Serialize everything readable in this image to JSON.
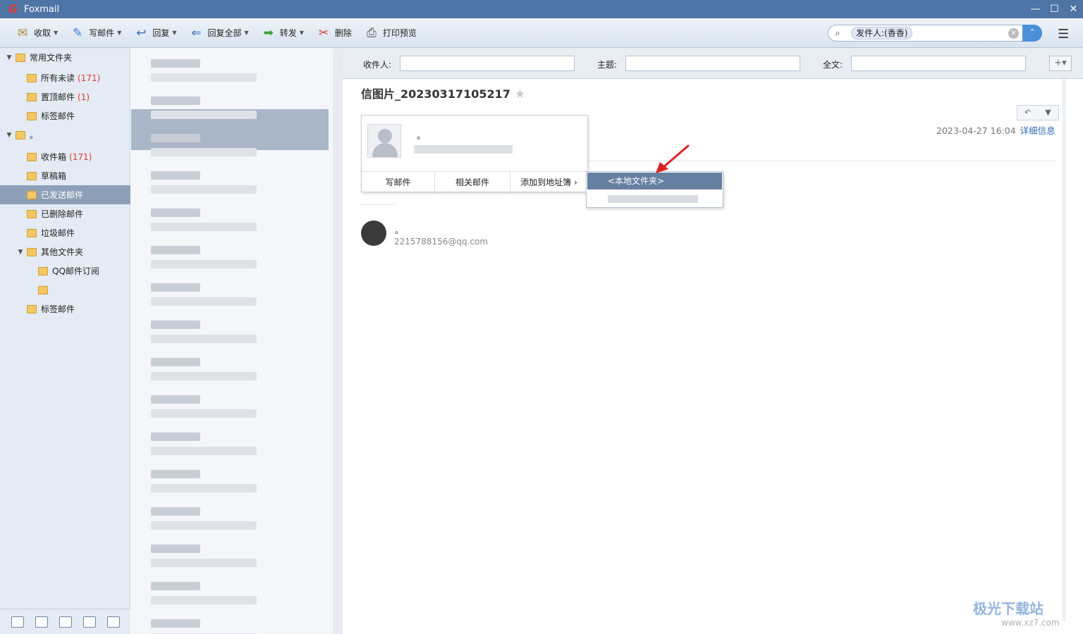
{
  "window": {
    "title": "Foxmail",
    "controls": [
      "—",
      "☐",
      "✕"
    ]
  },
  "toolbar": {
    "items": [
      {
        "label": "收取",
        "icon": "inbox-icon",
        "glyph": "✉",
        "caret": "▼"
      },
      {
        "label": "写邮件",
        "icon": "feather-pen-icon",
        "glyph": "✎",
        "caret": "▼"
      },
      {
        "label": "回复",
        "icon": "reply-icon",
        "glyph": "↩",
        "caret": "▼"
      },
      {
        "label": "回复全部",
        "icon": "reply-all-icon",
        "glyph": "⇐",
        "caret": "▼"
      },
      {
        "label": "转发",
        "icon": "forward-icon",
        "glyph": "➡",
        "caret": "▼"
      },
      {
        "label": "删除",
        "icon": "delete-icon",
        "glyph": "✂",
        "caret": ""
      },
      {
        "label": "打印预览",
        "icon": "print-icon",
        "glyph": "⎙",
        "caret": ""
      }
    ],
    "search_chip": "发件人:(香香)"
  },
  "sidebar": {
    "items": [
      {
        "label": "常用文件夹",
        "count": "",
        "level": 0,
        "tri": "▼"
      },
      {
        "label": "所有未读",
        "count": "(171)",
        "level": 1
      },
      {
        "label": "置顶邮件",
        "count": "(1)",
        "level": 1
      },
      {
        "label": "标签邮件",
        "count": "",
        "level": 1
      },
      {
        "label": "。",
        "count": "",
        "level": 0,
        "tri": "▼"
      },
      {
        "label": "收件箱",
        "count": "(171)",
        "level": 1
      },
      {
        "label": "草稿箱",
        "count": "",
        "level": 1
      },
      {
        "label": "已发送邮件",
        "count": "",
        "level": 1,
        "selected": true
      },
      {
        "label": "已删除邮件",
        "count": "",
        "level": 1
      },
      {
        "label": "垃圾邮件",
        "count": "",
        "level": 1
      },
      {
        "label": "其他文件夹",
        "count": "",
        "level": 1,
        "tri": "▼"
      },
      {
        "label": "QQ邮件订阅",
        "count": "",
        "level": 2
      },
      {
        "label": "",
        "count": "",
        "level": 2
      },
      {
        "label": "标签邮件",
        "count": "",
        "level": 1
      }
    ]
  },
  "filter": {
    "recipient_label": "收件人:",
    "subject_label": "主题:",
    "fulltext_label": "全文:",
    "plus": "+▾"
  },
  "mail": {
    "subject": "信图片_20230317105217",
    "date": "2023-04-27 16:04",
    "detail_link": "详细信息",
    "sender_name": "。",
    "sender_email": "2215788156@qq.com"
  },
  "popup": {
    "name": "。",
    "actions": [
      "写邮件",
      "相关邮件",
      "添加到地址簿"
    ],
    "chevron": "›",
    "submenu_item": "<本地文件夹>"
  },
  "watermark": {
    "line1": "极光下载站",
    "line2": "www.xz7.com"
  }
}
